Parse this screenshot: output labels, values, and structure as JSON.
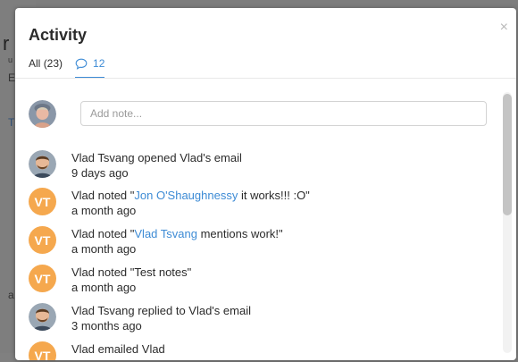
{
  "background": {
    "chars": [
      "r",
      "u",
      "E",
      "T",
      "a"
    ]
  },
  "modal": {
    "title": "Activity",
    "close_label": "×",
    "tabs": {
      "all_label": "All",
      "all_count": "(23)",
      "notes_count": "12",
      "notes_icon": "speech-bubble-icon"
    },
    "note_input": {
      "placeholder": "Add note...",
      "value": ""
    },
    "items": [
      {
        "avatar": "photo",
        "text": "Vlad Tsvang opened Vlad's email",
        "time": "9 days ago"
      },
      {
        "avatar": "initials",
        "initials": "VT",
        "prefix": "Vlad noted \"",
        "link": "Jon O'Shaughnessy",
        "suffix": " it works!!! :O\"",
        "time": "a month ago"
      },
      {
        "avatar": "initials",
        "initials": "VT",
        "prefix": "Vlad noted \"",
        "link": "Vlad Tsvang",
        "suffix": " mentions work!\"",
        "time": "a month ago"
      },
      {
        "avatar": "initials",
        "initials": "VT",
        "text": "Vlad noted \"Test notes\"",
        "time": "a month ago"
      },
      {
        "avatar": "photo",
        "text": "Vlad Tsvang replied to Vlad's email",
        "time": "3 months ago"
      },
      {
        "avatar": "initials",
        "initials": "VT",
        "text": "Vlad emailed Vlad",
        "time": ""
      }
    ]
  },
  "colors": {
    "accent": "#3d8bd5",
    "initials_avatar": "#f5a84e",
    "backdrop": "#7d7d7d"
  }
}
